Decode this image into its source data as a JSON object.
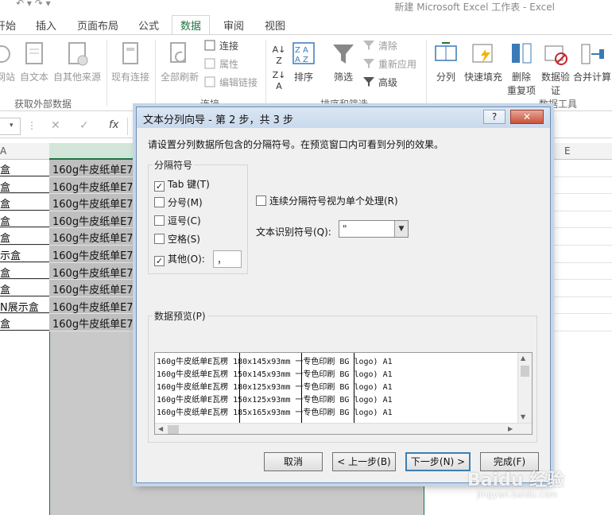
{
  "window": {
    "title": "新建 Microsoft Excel 工作表 - Excel"
  },
  "ribbon_tabs": [
    {
      "label": "开始"
    },
    {
      "label": "插入"
    },
    {
      "label": "页面布局"
    },
    {
      "label": "公式"
    },
    {
      "label": "数据"
    },
    {
      "label": "审阅"
    },
    {
      "label": "视图"
    }
  ],
  "ribbon": {
    "external": {
      "web": "网站",
      "text": "自文本",
      "other": "自其他来源",
      "existing": "现有连接",
      "group": "获取外部数据"
    },
    "connections": {
      "refresh_all": "全部刷新",
      "connections": "连接",
      "properties": "属性",
      "edit_links": "编辑链接",
      "group": "连接"
    },
    "sort_filter": {
      "sort": "排序",
      "filter": "筛选",
      "clear": "清除",
      "reapply": "重新应用",
      "advanced": "高级",
      "group": "排序和筛选"
    },
    "data_tools": {
      "text_to_columns": "分列",
      "flash_fill": "快速填充",
      "remove_dup_1": "删除",
      "remove_dup_2": "重复项",
      "validation_1": "数据验",
      "validation_2": "证",
      "consolidate": "合并计算",
      "group": "数据工具"
    }
  },
  "formula_bar": {
    "fx": "fx"
  },
  "columns": {
    "a": "A",
    "e": "E"
  },
  "cells_a": [
    "盒",
    "盒",
    "盒",
    "盒",
    "盒",
    "示盒",
    "盒",
    "盒",
    "N展示盒",
    "盒"
  ],
  "cells_b": [
    "160g牛皮纸单E7",
    "160g牛皮纸单E7",
    "160g牛皮纸单E7",
    "160g牛皮纸单E7",
    "160g牛皮纸单E7",
    "160g牛皮纸单E7",
    "160g牛皮纸单E7",
    "160g牛皮纸单E7",
    "160g牛皮纸单E7",
    "160g牛皮纸单E7"
  ],
  "dialog": {
    "title": "文本分列向导 - 第 2 步，共 3 步",
    "help": "?",
    "close": "✕",
    "instruction": "请设置分列数据所包含的分隔符号。在预览窗口内可看到分列的效果。",
    "delimiters_title": "分隔符号",
    "tab": "Tab 键(T)",
    "semicolon": "分号(M)",
    "comma": "逗号(C)",
    "space": "空格(S)",
    "other": "其他(O):",
    "other_value": "，",
    "consecutive": "连续分隔符号视为单个处理(R)",
    "qualifier_label": "文本识别符号(Q):",
    "qualifier_value": "\"",
    "preview_title": "数据预览(P)",
    "preview_rows": [
      "160g牛皮纸单E瓦楞 180x145x93mm 一专色印刷 BG logo) A1",
      "160g牛皮纸单E瓦楞 150x145x93mm 一专色印刷 BG logo) A1",
      "160g牛皮纸单E瓦楞 180x125x93mm 一专色印刷 BG logo) A1",
      "160g牛皮纸单E瓦楞 150x125x93mm 一专色印刷 BG logo) A1",
      "160g牛皮纸单E瓦楞 185x165x93mm 一专色印刷 BG logo) A1"
    ],
    "buttons": {
      "cancel": "取消",
      "back": "< 上一步(B)",
      "next": "下一步(N) >",
      "finish": "完成(F)"
    },
    "checks": {
      "tab": true,
      "semicolon": false,
      "comma": false,
      "space": false,
      "other": true,
      "consecutive": false
    }
  },
  "watermark": {
    "brand": "Baidu 经验",
    "site": "jingyan.baidu.com"
  },
  "colors": {
    "excel_green": "#217346",
    "selected_column": "#c9c9c9",
    "dialog_bg": "#f0f0f0"
  }
}
